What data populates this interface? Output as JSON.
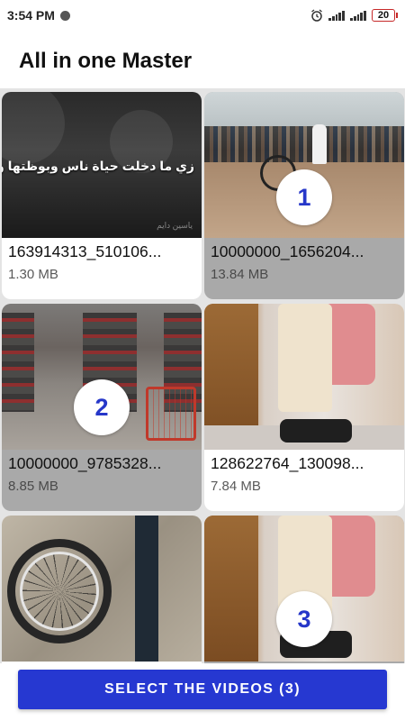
{
  "status_bar": {
    "time": "3:54 PM",
    "battery": "20",
    "icons": [
      "notification-icon",
      "alarm-icon",
      "signal-icon",
      "signal-icon",
      "battery-icon"
    ]
  },
  "app": {
    "title": "All in one Master"
  },
  "videos": [
    {
      "name": "163914313_510106...",
      "size": "1.30 MB",
      "selected": false,
      "badge": "",
      "caption": "زي ما دخلت حياة  ناس وبوظتها واذيتها",
      "watermark": "ياسين دايم"
    },
    {
      "name": "10000000_1656204...",
      "size": "13.84 MB",
      "selected": true,
      "badge": "1"
    },
    {
      "name": "10000000_9785328...",
      "size": "8.85 MB",
      "selected": true,
      "badge": "2"
    },
    {
      "name": "128622764_130098...",
      "size": "7.84 MB",
      "selected": false,
      "badge": ""
    },
    {
      "name": "",
      "size": "",
      "selected": false,
      "badge": ""
    },
    {
      "name": "",
      "size": "",
      "selected": true,
      "badge": "3"
    }
  ],
  "footer": {
    "button_label": "SELECT THE VIDEOS (3)"
  },
  "colors": {
    "accent": "#2638d1",
    "badge_text": "#2637c9",
    "selected_card": "#a9a9a9",
    "battery_border": "#c62828"
  }
}
